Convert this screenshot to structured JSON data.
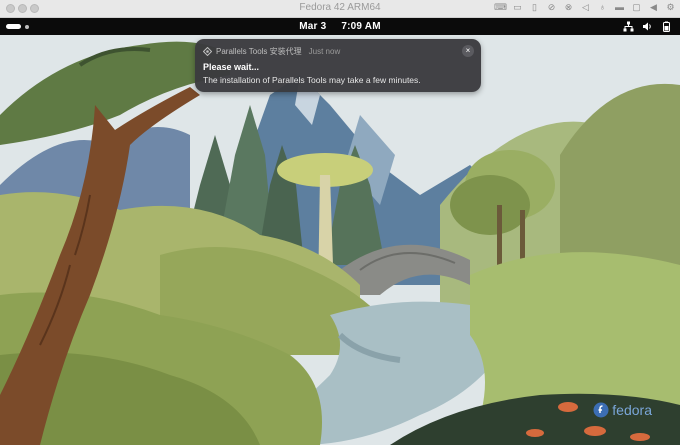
{
  "window": {
    "title": "Fedora 42 ARM64",
    "toolbar_icons": [
      "keyboard-icon",
      "display-icon",
      "usb-icon",
      "network-blocked-icon",
      "camera-blocked-icon",
      "volume-icon",
      "microphone-icon",
      "drive-icon",
      "folder-icon",
      "play-back-icon",
      "settings-gear-icon"
    ]
  },
  "topbar": {
    "date": "Mar 3",
    "time": "7:09 AM",
    "tray_icons": [
      "network-wired-icon",
      "volume-icon",
      "battery-icon"
    ]
  },
  "notification": {
    "app_name": "Parallels Tools 安装代理",
    "timestamp": "Just now",
    "title": "Please wait...",
    "body": "The installation of Parallels Tools may take a few minutes.",
    "close_symbol": "×"
  },
  "watermark": {
    "text": "fedora",
    "color": "#7aa6d8"
  }
}
